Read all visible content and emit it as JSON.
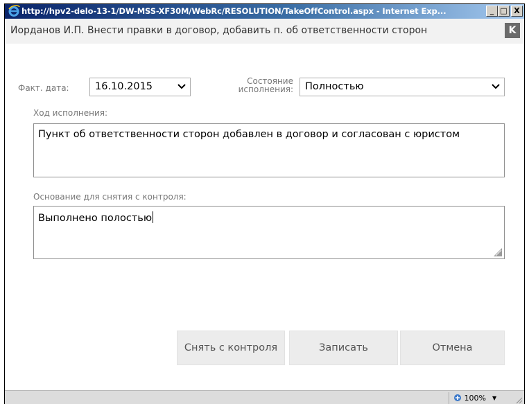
{
  "window": {
    "title": "http://hpv2-delo-13-1/DW-MSS-XF30M/WebRc/RESOLUTION/TakeOffControl.aspx - Internet Exp...",
    "minimize_label": "_",
    "maximize_label": "□",
    "close_label": "X"
  },
  "header": {
    "title": "Иорданов И.П. Внести правки в договор, добавить п. об ответственности сторон",
    "k_label": "K"
  },
  "form": {
    "fact_date": {
      "label": "Факт. дата:",
      "value": "16.10.2015"
    },
    "status": {
      "label_line1": "Состояние",
      "label_line2": "исполнения:",
      "value": "Полностью"
    },
    "progress": {
      "label": "Ход исполнения:",
      "value": "Пункт об ответственности сторон добавлен в договор и согласован с юристом"
    },
    "basis": {
      "label": "Основание для снятия с контроля:",
      "value": "Выполнено полостью"
    }
  },
  "buttons": {
    "take_off": "Снять с контроля",
    "save": "Записать",
    "cancel": "Отмена"
  },
  "statusbar": {
    "zoom": "100%",
    "zoom_arrow": "▼"
  },
  "icons": {
    "browser": "internet-explorer-icon",
    "dropdown": "chevron-down-icon",
    "resize": "resize-grip-icon",
    "zoom": "zoom-icon"
  },
  "colors": {
    "titlebar_start": "#0a246a",
    "titlebar_end": "#a6caf0",
    "header_bg": "#f2f2f2",
    "k_button_bg": "#6b6b6b",
    "button_bg": "#ececec"
  }
}
